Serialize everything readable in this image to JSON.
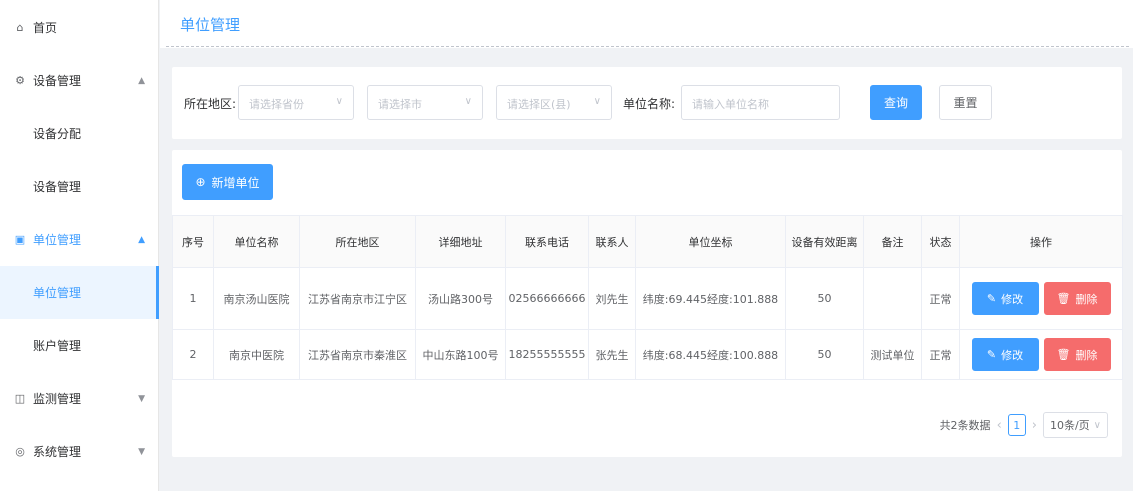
{
  "sidebar": {
    "home": "首页",
    "device_mgmt": "设备管理",
    "device_assign": "设备分配",
    "device_manage": "设备管理",
    "unit_mgmt": "单位管理",
    "unit_manage": "单位管理",
    "account_mgmt": "账户管理",
    "monitor_mgmt": "监测管理",
    "system_mgmt": "系统管理"
  },
  "page": {
    "title": "单位管理"
  },
  "filters": {
    "region_label": "所在地区:",
    "province_placeholder": "请选择省份",
    "city_placeholder": "请选择市",
    "district_placeholder": "请选择区(县)",
    "name_label": "单位名称:",
    "name_placeholder": "请输入单位名称",
    "query_button": "查询",
    "reset_button": "重置"
  },
  "toolbar": {
    "add_button": "新增单位"
  },
  "table": {
    "headers": [
      "序号",
      "单位名称",
      "所在地区",
      "详细地址",
      "联系电话",
      "联系人",
      "单位坐标",
      "设备有效距离",
      "备注",
      "状态",
      "操作"
    ],
    "rows": [
      {
        "index": "1",
        "name": "南京汤山医院",
        "region": "江苏省南京市江宁区",
        "address": "汤山路300号",
        "phone": "02566666666",
        "contact": "刘先生",
        "coords": "纬度:69.445经度:101.888",
        "distance": "50",
        "remark": "",
        "status": "正常"
      },
      {
        "index": "2",
        "name": "南京中医院",
        "region": "江苏省南京市秦淮区",
        "address": "中山东路100号",
        "phone": "18255555555",
        "contact": "张先生",
        "coords": "纬度:68.445经度:100.888",
        "distance": "50",
        "remark": "测试单位",
        "status": "正常"
      }
    ],
    "edit_label": "修改",
    "delete_label": "删除"
  },
  "pagination": {
    "total_text": "共2条数据",
    "current_page": "1",
    "page_size": "10条/页"
  },
  "colors": {
    "primary": "#409eff",
    "danger": "#f56c6c",
    "success": "#13ce66"
  }
}
